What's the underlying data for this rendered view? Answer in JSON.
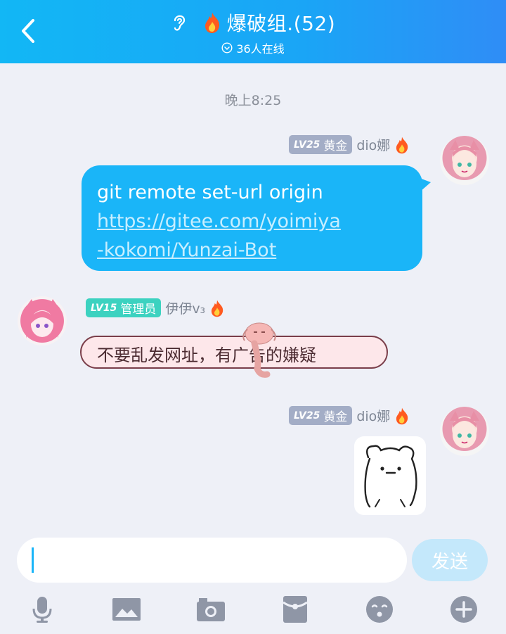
{
  "header": {
    "title": "爆破组.(52)",
    "online": "36人在线"
  },
  "chat": {
    "timestamp": "晚上8:25",
    "messages": [
      {
        "sender": "dio娜",
        "level": "LV25",
        "title": "黄金",
        "line1": "git remote set-url origin",
        "link_line1": "https://gitee.com/yoimiya",
        "link_line2": "-kokomi/Yunzai-Bot"
      },
      {
        "sender": "伊伊v₃",
        "level": "LV15",
        "title": "管理员",
        "text": "不要乱发网址，有广告的嫌疑"
      },
      {
        "sender": "dio娜",
        "level": "LV25",
        "title": "黄金"
      }
    ]
  },
  "input": {
    "value": "",
    "send_label": "发送"
  },
  "colors": {
    "header_gradient_start": "#12b7f5",
    "bubble_blue": "#1ab5f8",
    "bubble_pink": "#fde7ea",
    "admin_badge": "#3cd2c0",
    "gold_badge": "#a3adc6"
  }
}
